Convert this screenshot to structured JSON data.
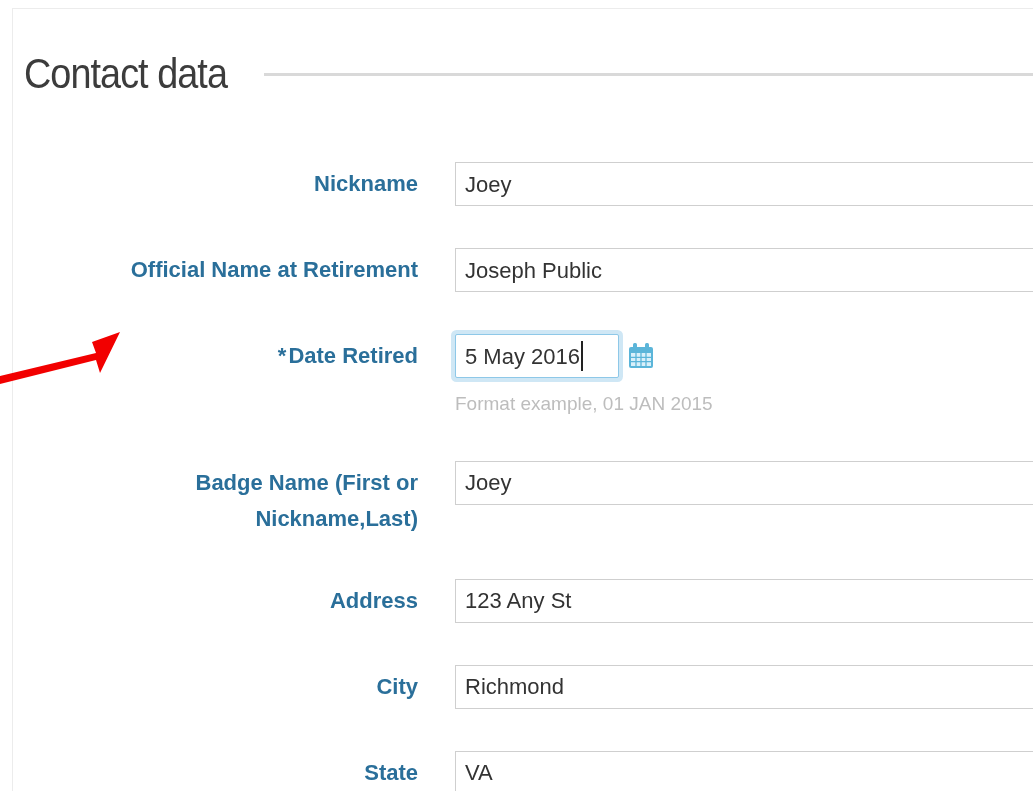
{
  "section": {
    "title": "Contact data"
  },
  "fields": [
    {
      "kind": "text",
      "label": "Nickname",
      "value": "Joey",
      "focused": false
    },
    {
      "kind": "text",
      "label": "Official Name at Retirement",
      "value": "Joseph Public",
      "focused": false
    },
    {
      "kind": "date",
      "marker": "*",
      "label": "Date Retired",
      "value": "5 May 2016",
      "focused": true,
      "hint": "Format example, 01 JAN 2015"
    },
    {
      "kind": "text",
      "label": "Badge Name (First or Nickname,Last)",
      "value": "Joey",
      "focused": false
    },
    {
      "kind": "text",
      "label": "Address",
      "value": "123 Any St",
      "focused": false
    },
    {
      "kind": "text",
      "label": "City",
      "value": "Richmond",
      "focused": false
    },
    {
      "kind": "text",
      "label": "State",
      "value": "VA",
      "focused": false
    }
  ]
}
